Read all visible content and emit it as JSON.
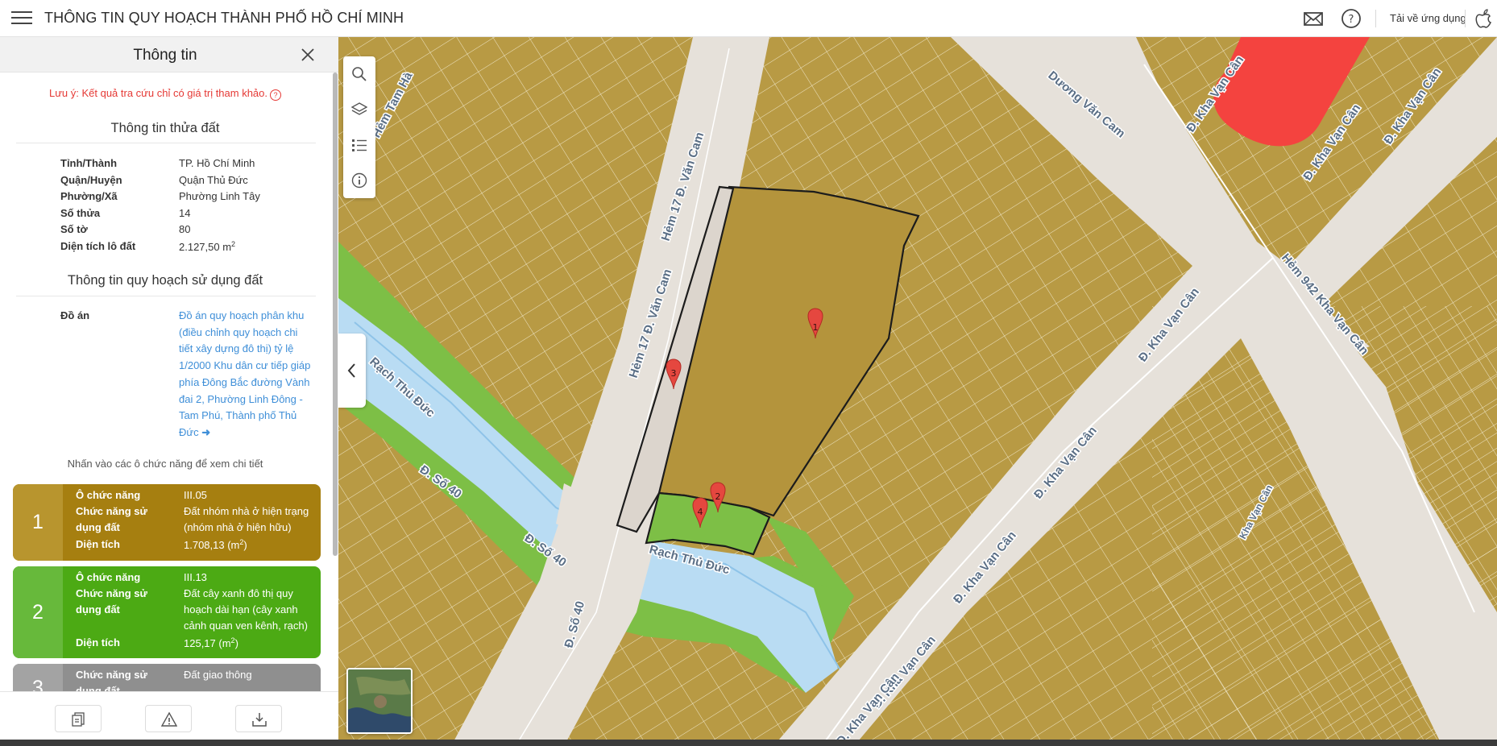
{
  "header": {
    "title": "THÔNG TIN QUY HOẠCH THÀNH PHỐ HỒ CHÍ MINH",
    "download_app": "Tải về ứng dụng",
    "icons": [
      "menu-icon",
      "mail-icon",
      "help-icon",
      "apple-icon"
    ]
  },
  "panel": {
    "title": "Thông tin",
    "note": "Lưu ý: Kết quả tra cứu chỉ có giá trị tham khảo.",
    "land_section_title": "Thông tin thửa đất",
    "land_info": [
      {
        "label": "Tỉnh/Thành",
        "value": "TP. Hồ Chí Minh"
      },
      {
        "label": "Quận/Huyện",
        "value": "Quận Thủ Đức"
      },
      {
        "label": "Phường/Xã",
        "value": "Phường Linh Tây"
      },
      {
        "label": "Số thửa",
        "value": "14"
      },
      {
        "label": "Số tờ",
        "value": "80"
      },
      {
        "label": "Diện tích lô đất",
        "value": "2.127,50 m",
        "sup": "2"
      }
    ],
    "plan_section_title": "Thông tin quy hoạch sử dụng đất",
    "plan_label": "Đồ án",
    "plan_link": "Đồ án quy hoạch phân khu (điều chỉnh quy hoạch chi tiết xây dựng đô thị) tỷ lệ 1/2000 Khu dân cư tiếp giáp phía Đông Bắc đường Vành đai 2, Phường Linh Đông - Tam Phú, Thành phố Thủ Đức",
    "hint": "Nhấn vào các ô chức năng để xem chi tiết",
    "cards": [
      {
        "num": "1",
        "color": "#b08a1c",
        "cell_label": "Ô chức năng",
        "cell_value": "III.05",
        "use_label_1": "Chức năng sử",
        "use_label_2": "dụng đất",
        "use_value_1": "Đất nhóm nhà ở hiện trạng",
        "use_value_2": "(nhóm nhà ở hiện hữu)",
        "area_label": "Diện tích",
        "area_value": "1.708,13 (m",
        "area_tail": ")"
      },
      {
        "num": "2",
        "color": "#4caa14",
        "cell_label": "Ô chức năng",
        "cell_value": "III.13",
        "use_label_1": "Chức năng sử",
        "use_label_2": "dụng đất",
        "use_value_1": "Đất cây xanh đô thị quy",
        "use_value_2": "hoạch dài hạn (cây xanh",
        "use_value_3": "cảnh quan ven kênh, rạch)",
        "area_label": "Diện tích",
        "area_value": "125,17 (m",
        "area_tail": ")"
      },
      {
        "num": "3",
        "color": "#8f8f8f",
        "use_label_1": "Chức năng sử",
        "use_label_2": "dụng đất",
        "use_value_1": "Đất giao thông"
      }
    ],
    "footer_icons": [
      "document-icon",
      "warning-icon",
      "download-icon"
    ]
  },
  "map": {
    "roads": [
      "Hẻm 17 Đ. Văn Cam",
      "Hẻm 17 Đ. Văn Cam",
      "Đ. Kha Vạn Cân",
      "Đ. Kha Vạn Cân",
      "Đ. Kha Vạn Cân",
      "Đ. Kha Vạn Cân",
      "Đ. Kha Vạn Cân",
      "Đ. Kha Vạn Cân",
      "Đ. Kha Vạn Cân",
      "Dương Văn Cam",
      "Hẻm 942 Kha Vạn Cân",
      "Đ. Số 40",
      "Đ. Số 40",
      "Đ. Số 40",
      "Rạch Thủ Đức",
      "Rạch Thủ Đức",
      "Hẻm Tam Hà",
      "Đ. Kha Vạn Cân",
      "Kha Vạn Cân"
    ],
    "markers": [
      "1",
      "2",
      "3",
      "4"
    ],
    "tools": [
      "search-icon",
      "layers-icon",
      "legend-icon",
      "info-icon"
    ],
    "colors": {
      "residential": "#b89a44",
      "parcel": "#b4943c",
      "road": "#e6e1da",
      "green": "#7dbf46",
      "water": "#b9dcf3",
      "red_zone": "#f4433f",
      "marker": "#e5473f"
    }
  }
}
